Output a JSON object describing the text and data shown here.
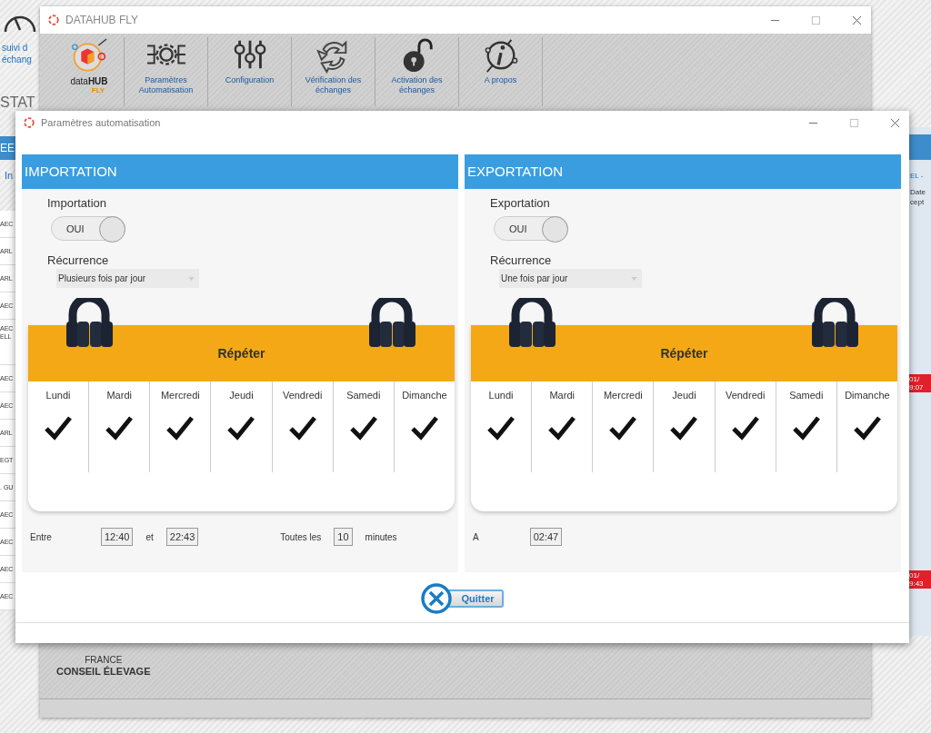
{
  "background_app": {
    "left_link": "suivi d échang",
    "left_heading": "STAT",
    "left_band": "EE",
    "left_subheading": "In",
    "left_rows": [
      "AEC",
      "ARL",
      "ARL",
      "AEC",
      "AEC ELL",
      "AEC",
      "AEC",
      "ARL",
      "EGT",
      ". GU",
      "AEC",
      "AEC",
      "AEC",
      "AEC"
    ],
    "right_heading": "EL -",
    "right_subheading": "Date cept",
    "right_badges": [
      "01/ 9:07",
      "01/ 9:43"
    ]
  },
  "main_window": {
    "title": "DATAHUB FLY",
    "logo": {
      "text": "data**HUB**",
      "sub": "FLY"
    },
    "toolbar": [
      {
        "kind": "gear",
        "label": "Paramètres Automatisation"
      },
      {
        "kind": "sliders",
        "label": "Configuration"
      },
      {
        "kind": "cycle",
        "label": "Vérification des échanges"
      },
      {
        "kind": "lock",
        "label": "Activation des échanges"
      },
      {
        "kind": "info",
        "label": "A propos"
      }
    ],
    "footer_logo": [
      "FRANCE",
      "CONSEIL ÉLEVAGE"
    ]
  },
  "dialog": {
    "title": "Paramètres automatisation",
    "panels": [
      {
        "header": "IMPORTATION",
        "toggle_label": "Importation",
        "toggle": {
          "text": "OUI",
          "on": true
        },
        "recurrence_label": "Récurrence",
        "recurrence_value": "Plusieurs fois par jour",
        "repeat_title": "Répéter",
        "days": [
          {
            "label": "Lundi",
            "checked": true
          },
          {
            "label": "Mardi",
            "checked": true
          },
          {
            "label": "Mercredi",
            "checked": true
          },
          {
            "label": "Jeudi",
            "checked": true
          },
          {
            "label": "Vendredi",
            "checked": true
          },
          {
            "label": "Samedi",
            "checked": true
          },
          {
            "label": "Dimanche",
            "checked": true
          }
        ],
        "schedule": [
          {
            "kind": "label",
            "text": "Entre"
          },
          {
            "kind": "field",
            "text": "12:40"
          },
          {
            "kind": "label",
            "text": "et"
          },
          {
            "kind": "field",
            "text": "22:43"
          },
          {
            "kind": "label",
            "text": "Toutes les"
          },
          {
            "kind": "field",
            "text": "10"
          },
          {
            "kind": "label",
            "text": "minutes"
          }
        ]
      },
      {
        "header": "EXPORTATION",
        "toggle_label": "Exportation",
        "toggle": {
          "text": "OUI",
          "on": true
        },
        "recurrence_label": "Récurrence",
        "recurrence_value": "Une fois par jour",
        "repeat_title": "Répéter",
        "days": [
          {
            "label": "Lundi",
            "checked": true
          },
          {
            "label": "Mardi",
            "checked": true
          },
          {
            "label": "Mercredi",
            "checked": true
          },
          {
            "label": "Jeudi",
            "checked": true
          },
          {
            "label": "Vendredi",
            "checked": true
          },
          {
            "label": "Samedi",
            "checked": true
          },
          {
            "label": "Dimanche",
            "checked": true
          }
        ],
        "schedule": [
          {
            "kind": "label",
            "text": "A"
          },
          {
            "kind": "field",
            "text": "02:47"
          }
        ]
      }
    ],
    "quit_button": "Quitter"
  }
}
